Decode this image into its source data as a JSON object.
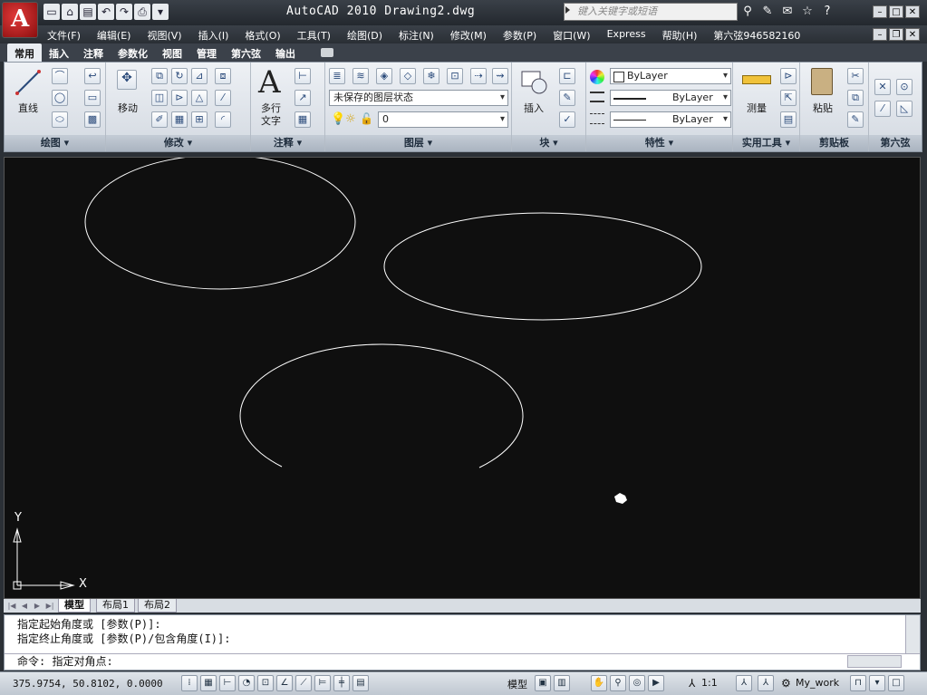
{
  "title": {
    "app": "AutoCAD 2010",
    "file": "Drawing2.dwg",
    "text": "AutoCAD 2010   Drawing2.dwg"
  },
  "search": {
    "placeholder": "键入关键字或短语"
  },
  "menu": [
    "文件(F)",
    "编辑(E)",
    "视图(V)",
    "插入(I)",
    "格式(O)",
    "工具(T)",
    "绘图(D)",
    "标注(N)",
    "修改(M)",
    "参数(P)",
    "窗口(W)",
    "Express",
    "帮助(H)",
    "第六弦946582160"
  ],
  "ribbon_tabs": [
    "常用",
    "插入",
    "注释",
    "参数化",
    "视图",
    "管理",
    "第六弦",
    "输出"
  ],
  "panels": {
    "draw": {
      "title": "绘图",
      "line_label": "直线"
    },
    "modify": {
      "title": "修改",
      "move_label": "移动"
    },
    "annotate": {
      "title": "注释",
      "text_label_1": "多行",
      "text_label_2": "文字"
    },
    "layers": {
      "title": "图层",
      "layer_state": "未保存的图层状态",
      "layer_current": "0"
    },
    "block": {
      "title": "块",
      "insert_label": "插入"
    },
    "properties": {
      "title": "特性",
      "color": "ByLayer",
      "linetype": "ByLayer",
      "lineweight": "ByLayer"
    },
    "utilities": {
      "title": "实用工具",
      "measure_label": "测量"
    },
    "clipboard": {
      "title": "剪贴板",
      "paste_label": "粘贴"
    },
    "sixth": {
      "title": "第六弦"
    }
  },
  "ucs": {
    "x": "X",
    "y": "Y"
  },
  "layout_tabs": [
    "模型",
    "布局1",
    "布局2"
  ],
  "command": {
    "history": [
      "指定起始角度或 [参数(P)]:",
      "指定终止角度或 [参数(P)/包含角度(I)]:"
    ],
    "prompt": "命令: 指定对角点:"
  },
  "status": {
    "coords": "375.9754, 50.8102, 0.0000",
    "model": "模型",
    "scale": "1:1",
    "workspace": "My_work"
  },
  "colors": {
    "canvas": "#0f0f0f",
    "geometry": "#ffffff",
    "ribbon": "#eef1f5",
    "titlebar": "#23282e"
  }
}
